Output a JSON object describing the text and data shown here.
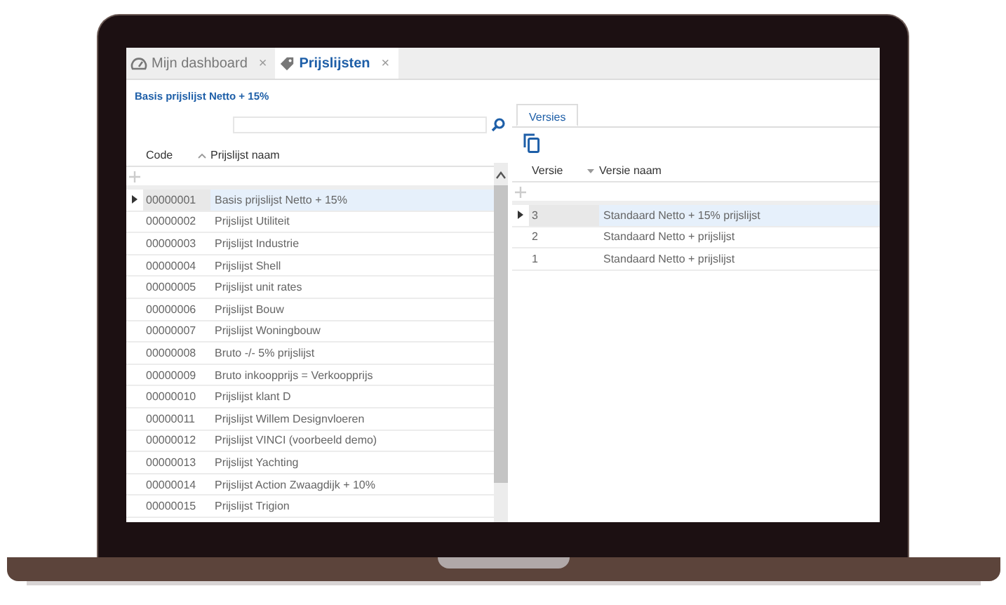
{
  "tabs": [
    {
      "label": "Mijn dashboard",
      "kind": "dashboard",
      "selected": false,
      "close": "×"
    },
    {
      "label": "Prijslijsten",
      "kind": "tag",
      "selected": true,
      "close": "×"
    }
  ],
  "title": "Basis prijslijst Netto + 15%",
  "left": {
    "columns": [
      {
        "label": "Code",
        "sorted": false
      },
      {
        "label": "Prijslijst naam",
        "sorted": true,
        "descending": false
      }
    ],
    "rows": [
      {
        "code": "00000001",
        "name": "Basis prijslijst Netto + 15%",
        "selected": true
      },
      {
        "code": "00000002",
        "name": "Prijslijst Utiliteit",
        "selected": false
      },
      {
        "code": "00000003",
        "name": "Prijslijst Industrie",
        "selected": false
      },
      {
        "code": "00000004",
        "name": "Prijslijst Shell",
        "selected": false
      },
      {
        "code": "00000005",
        "name": "Prijslijst unit rates",
        "selected": false
      },
      {
        "code": "00000006",
        "name": "Prijslijst Bouw",
        "selected": false
      },
      {
        "code": "00000007",
        "name": "Prijslijst Woningbouw",
        "selected": false
      },
      {
        "code": "00000008",
        "name": "Bruto -/- 5% prijslijst",
        "selected": false
      },
      {
        "code": "00000009",
        "name": "Bruto inkoopprijs = Verkoopprijs",
        "selected": false
      },
      {
        "code": "00000010",
        "name": "Prijslijst klant D",
        "selected": false
      },
      {
        "code": "00000011",
        "name": "Prijslijst Willem Designvloeren",
        "selected": false
      },
      {
        "code": "00000012",
        "name": "Prijslijst VINCI (voorbeeld demo)",
        "selected": false
      },
      {
        "code": "00000013",
        "name": "Prijslijst Yachting",
        "selected": false
      },
      {
        "code": "00000014",
        "name": "Prijslijst Action Zwaagdijk + 10%",
        "selected": false
      },
      {
        "code": "00000015",
        "name": "Prijslijst Trigion",
        "selected": false
      }
    ]
  },
  "right": {
    "tabs": [
      {
        "label": "Versies",
        "selected": true
      }
    ],
    "columns": [
      {
        "label": "Versie",
        "sorted": false
      },
      {
        "label": "Versie naam",
        "sorted": true,
        "descending": true
      }
    ],
    "rows": [
      {
        "code": "3",
        "name": "Standaard Netto + 15% prijslijst",
        "selected": true
      },
      {
        "code": "2",
        "name": "Standaard Netto + prijslijst",
        "selected": false
      },
      {
        "code": "1",
        "name": "Standaard Netto + prijslijst",
        "selected": false
      }
    ]
  }
}
